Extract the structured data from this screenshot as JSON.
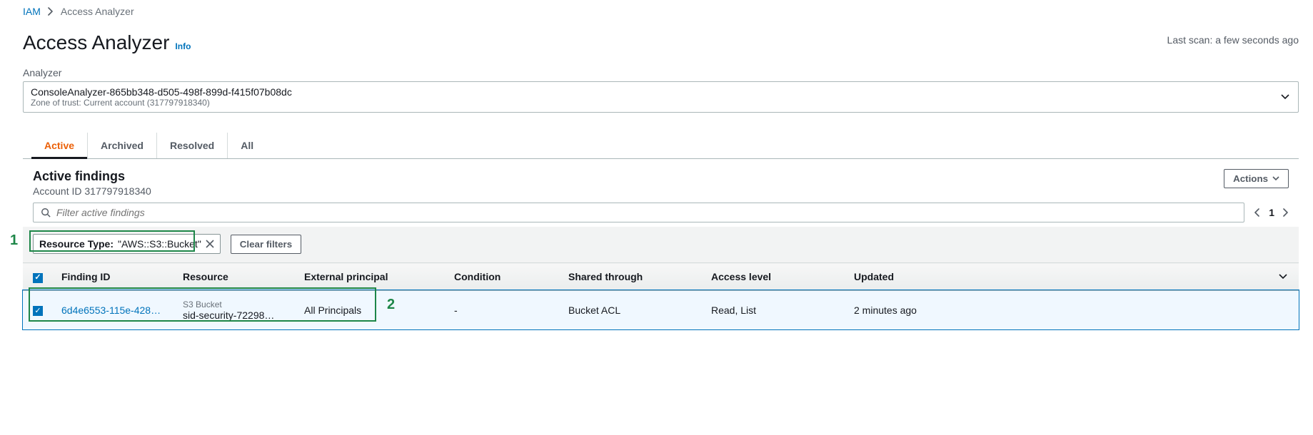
{
  "breadcrumb": {
    "root": "IAM",
    "current": "Access Analyzer"
  },
  "header": {
    "title": "Access Analyzer",
    "info": "Info",
    "last_scan": "Last scan: a few seconds ago"
  },
  "analyzer": {
    "label": "Analyzer",
    "name": "ConsoleAnalyzer-865bb348-d505-498f-899d-f415f07b08dc",
    "zone": "Zone of trust: Current account (317797918340)"
  },
  "tabs": [
    "Active",
    "Archived",
    "Resolved",
    "All"
  ],
  "findings": {
    "title": "Active findings",
    "account": "Account ID 317797918340",
    "actions_label": "Actions",
    "filter_placeholder": "Filter active findings",
    "page_current": "1",
    "chip_key": "Resource Type:",
    "chip_value": " \"AWS::S3::Bucket\"",
    "clear_label": "Clear filters"
  },
  "table": {
    "headers": {
      "finding_id": "Finding ID",
      "resource": "Resource",
      "external_principal": "External principal",
      "condition": "Condition",
      "shared_through": "Shared through",
      "access_level": "Access level",
      "updated": "Updated"
    },
    "rows": [
      {
        "finding_id": "6d4e6553-115e-428…",
        "resource_type": "S3 Bucket",
        "resource_name": "sid-security-72298…",
        "external_principal": "All Principals",
        "condition": "-",
        "shared_through": "Bucket ACL",
        "access_level": "Read, List",
        "updated": "2 minutes ago"
      }
    ]
  },
  "annotations": {
    "one": "1",
    "two": "2"
  }
}
